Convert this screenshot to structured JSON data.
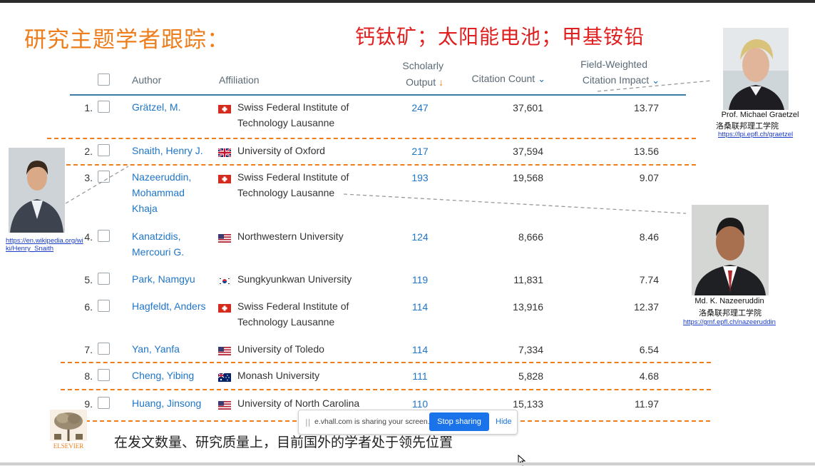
{
  "slide": {
    "title_left": "研究主题学者跟踪：",
    "title_right": "钙钛矿；太阳能电池；甲基铵铅",
    "bottom_text": "在发文数量、研究质量上，目前国外的学者处于领先位置",
    "logo_text": "ELSEVIER"
  },
  "table": {
    "headers": {
      "author": "Author",
      "affiliation": "Affiliation",
      "scholarly_1": "Scholarly",
      "scholarly_2": "Output",
      "scholarly_arrow": "↓",
      "citation": "Citation Count",
      "fwci_1": "Field-Weighted",
      "fwci_2": "Citation Impact",
      "chevron": "⌄"
    },
    "rows": [
      {
        "rank": "1.",
        "author_lines": [
          "Grätzel, M."
        ],
        "flag": "swiss",
        "affiliation_lines": [
          "Swiss Federal Institute of",
          "Technology Lausanne"
        ],
        "output": "247",
        "citations": "37,601",
        "fwci": "13.77"
      },
      {
        "rank": "2.",
        "author_lines": [
          "Snaith, Henry J."
        ],
        "flag": "uk",
        "affiliation_lines": [
          "University of Oxford"
        ],
        "output": "217",
        "citations": "37,594",
        "fwci": "13.56"
      },
      {
        "rank": "3.",
        "author_lines": [
          "Nazeeruddin,",
          "Mohammad",
          "Khaja"
        ],
        "flag": "swiss",
        "affiliation_lines": [
          "Swiss Federal Institute of",
          "Technology Lausanne"
        ],
        "output": "193",
        "citations": "19,568",
        "fwci": "9.07"
      },
      {
        "rank": "4.",
        "author_lines": [
          "Kanatzidis,",
          "Mercouri G."
        ],
        "flag": "us",
        "affiliation_lines": [
          "Northwestern University"
        ],
        "output": "124",
        "citations": "8,666",
        "fwci": "8.46"
      },
      {
        "rank": "5.",
        "author_lines": [
          "Park, Namgyu"
        ],
        "flag": "korea",
        "affiliation_lines": [
          "Sungkyunkwan University"
        ],
        "output": "119",
        "citations": "11,831",
        "fwci": "7.74"
      },
      {
        "rank": "6.",
        "author_lines": [
          "Hagfeldt, Anders"
        ],
        "flag": "swiss",
        "affiliation_lines": [
          "Swiss Federal Institute of",
          "Technology Lausanne"
        ],
        "output": "114",
        "citations": "13,916",
        "fwci": "12.37"
      },
      {
        "rank": "7.",
        "author_lines": [
          "Yan, Yanfa"
        ],
        "flag": "us",
        "affiliation_lines": [
          "University of Toledo"
        ],
        "output": "114",
        "citations": "7,334",
        "fwci": "6.54"
      },
      {
        "rank": "8.",
        "author_lines": [
          "Cheng, Yibing"
        ],
        "flag": "australia",
        "affiliation_lines": [
          "Monash University"
        ],
        "output": "111",
        "citations": "5,828",
        "fwci": "4.68"
      },
      {
        "rank": "9.",
        "author_lines": [
          "Huang, Jinsong"
        ],
        "flag": "us",
        "affiliation_lines": [
          "University of North Carolina"
        ],
        "output": "110",
        "citations": "15,133",
        "fwci": "11.97"
      }
    ]
  },
  "profiles": {
    "graetzel": {
      "name": "Prof. Michael Graetzel",
      "inst": "洛桑联邦理工学院",
      "link": "https://lpi.epfl.ch/graetzel"
    },
    "snaith": {
      "link_1": "https://en.wikipedia.org/wi",
      "link_2": "ki/Henry_Snaith"
    },
    "nazeeruddin": {
      "name": "Md. K. Nazeeruddin",
      "inst": "洛桑联邦理工学院",
      "link": "https://gmf.epfl.ch/nazeeruddin"
    }
  },
  "share_bar": {
    "grip": "||",
    "message": "e.vhall.com is sharing your screen.",
    "stop_label": "Stop sharing",
    "hide_label": "Hide"
  }
}
